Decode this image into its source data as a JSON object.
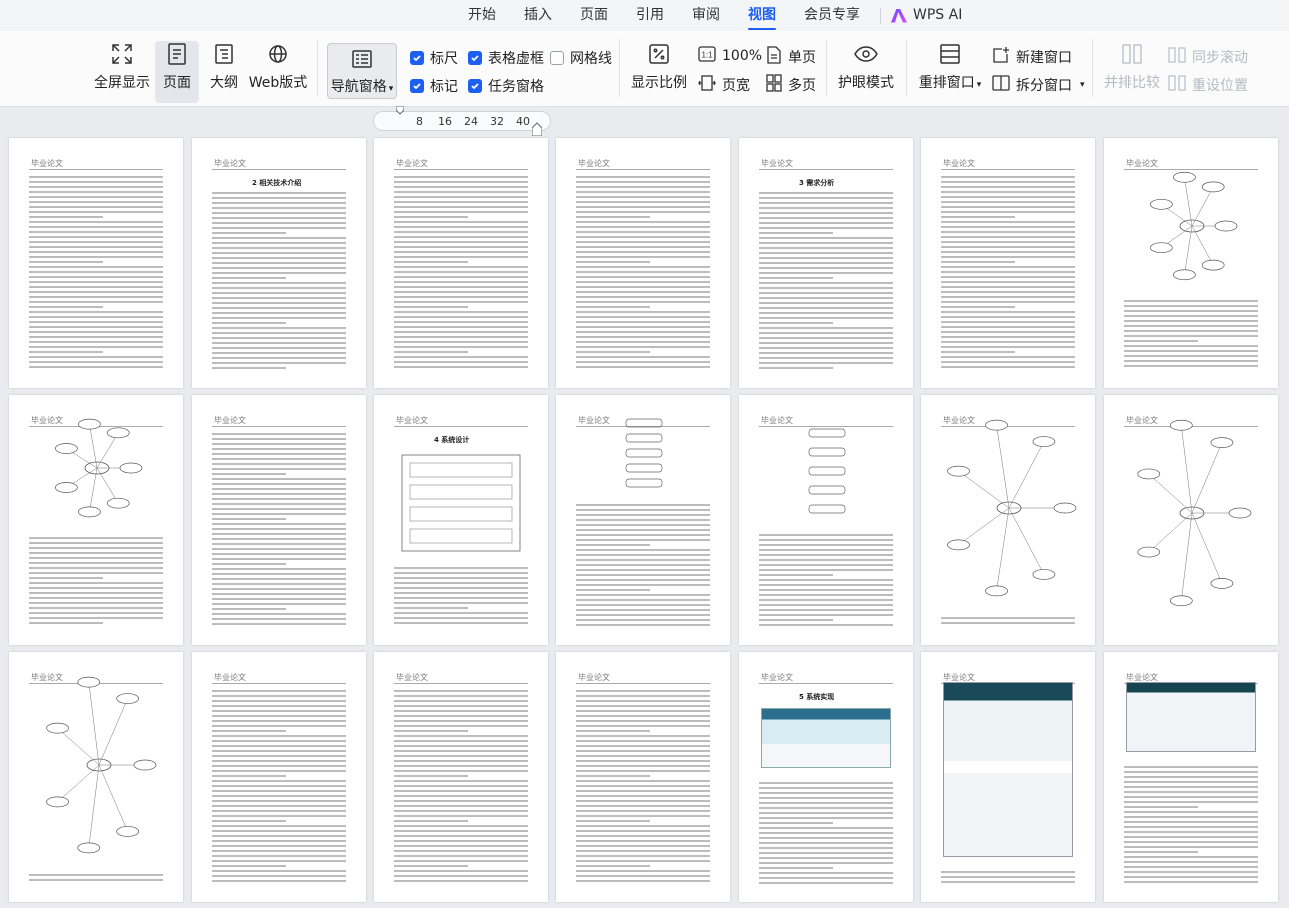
{
  "menu": {
    "items": [
      "开始",
      "插入",
      "页面",
      "引用",
      "审阅",
      "视图",
      "会员专享"
    ],
    "active": "视图",
    "ai_label": "WPS AI"
  },
  "ribbon": {
    "fullscreen": "全屏显示",
    "page": "页面",
    "outline": "大纲",
    "web": "Web版式",
    "nav_pane": "导航窗格",
    "ruler": "标尺",
    "table_grid": "表格虚框",
    "gridlines": "网格线",
    "marks": "标记",
    "task_pane": "任务窗格",
    "zoom": "显示比例",
    "zoom100": "100%",
    "page_width": "页宽",
    "single_page": "单页",
    "multi_page": "多页",
    "eye_mode": "护眼模式",
    "rearrange": "重排窗口",
    "split": "拆分窗口",
    "new_window": "新建窗口",
    "side_by_side": "并排比较",
    "sync_scroll": "同步滚动",
    "reset_position": "重设位置"
  },
  "zoom_slider": {
    "ticks": [
      "8",
      "16",
      "24",
      "32",
      "40"
    ]
  },
  "pages": {
    "header": "毕业论文",
    "titles": {
      "p2": "2 相关技术介绍",
      "p5": "3 需求分析",
      "p9": "4 系统设计",
      "p16": "5 系统实现"
    }
  },
  "colors": {
    "accent": "#1d5ff0",
    "ribbon_bg": "#fbfbfc",
    "canvas_bg": "#e9ebef"
  }
}
